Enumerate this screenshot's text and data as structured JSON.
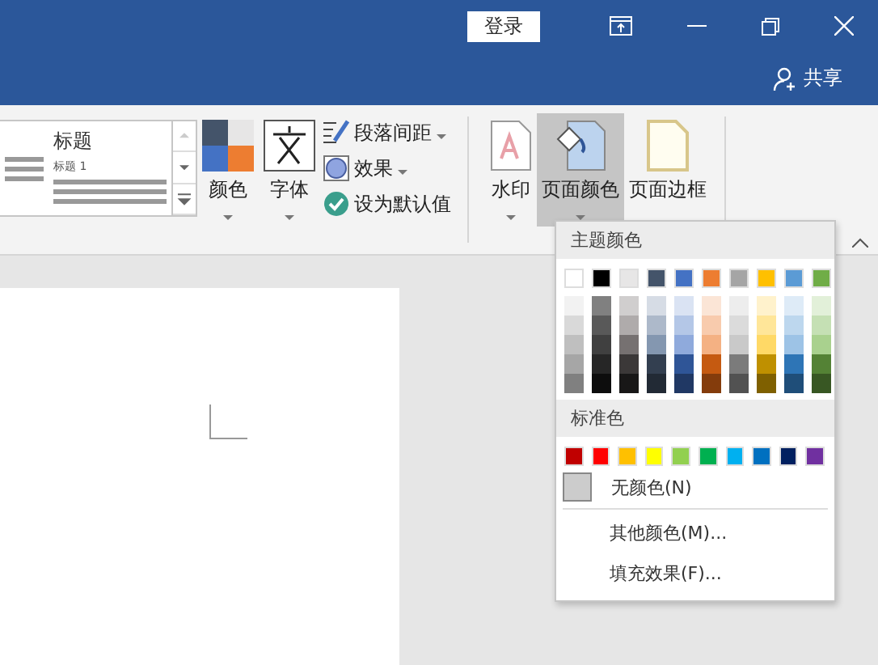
{
  "titlebar": {
    "login": "登录",
    "share": "共享"
  },
  "ribbon": {
    "gallery": {
      "title": "标题",
      "subtitle": "标题 1"
    },
    "colors_button": "颜色",
    "fonts_button": "字体",
    "small_buttons": [
      {
        "kind": "spacing",
        "label": "段落间距",
        "dropdown": true
      },
      {
        "kind": "effects",
        "label": "效果",
        "dropdown": true
      },
      {
        "kind": "default",
        "label": "设为默认值",
        "dropdown": false
      }
    ],
    "page_buttons": [
      {
        "kind": "watermark",
        "label": "水印",
        "dropdown": true,
        "selected": false
      },
      {
        "kind": "color",
        "label": "页面颜色",
        "dropdown": true,
        "selected": true
      },
      {
        "kind": "border",
        "label": "页面边框",
        "dropdown": false,
        "selected": false
      }
    ]
  },
  "menu": {
    "theme_header": "主题颜色",
    "theme_colors": [
      {
        "color": "#ffffff",
        "shades": [
          {
            "color": "#f2f2f2"
          },
          {
            "color": "#d9d9d9"
          },
          {
            "color": "#bfbfbf"
          },
          {
            "color": "#a6a6a6"
          },
          {
            "color": "#808080"
          }
        ]
      },
      {
        "color": "#000000",
        "shades": [
          {
            "color": "#808080"
          },
          {
            "color": "#595959"
          },
          {
            "color": "#404040"
          },
          {
            "color": "#262626"
          },
          {
            "color": "#0d0d0d"
          }
        ]
      },
      {
        "color": "#e7e6e6",
        "shades": [
          {
            "color": "#d0cece"
          },
          {
            "color": "#afabab"
          },
          {
            "color": "#767171"
          },
          {
            "color": "#3b3838"
          },
          {
            "color": "#181717"
          }
        ]
      },
      {
        "color": "#44546a",
        "shades": [
          {
            "color": "#d6dce5"
          },
          {
            "color": "#adb9ca"
          },
          {
            "color": "#8497b0"
          },
          {
            "color": "#333f50"
          },
          {
            "color": "#222a35"
          }
        ]
      },
      {
        "color": "#4472c4",
        "shades": [
          {
            "color": "#dae3f3"
          },
          {
            "color": "#b4c7e7"
          },
          {
            "color": "#8faadc"
          },
          {
            "color": "#2f5597"
          },
          {
            "color": "#203864"
          }
        ]
      },
      {
        "color": "#ed7d31",
        "shades": [
          {
            "color": "#fbe5d6"
          },
          {
            "color": "#f8cbad"
          },
          {
            "color": "#f4b183"
          },
          {
            "color": "#c55a11"
          },
          {
            "color": "#843c0c"
          }
        ]
      },
      {
        "color": "#a5a5a5",
        "shades": [
          {
            "color": "#ededed"
          },
          {
            "color": "#dbdbdb"
          },
          {
            "color": "#c9c9c9"
          },
          {
            "color": "#7b7b7b"
          },
          {
            "color": "#525252"
          }
        ]
      },
      {
        "color": "#ffc000",
        "shades": [
          {
            "color": "#fff2cc"
          },
          {
            "color": "#ffe699"
          },
          {
            "color": "#ffd966"
          },
          {
            "color": "#bf9000"
          },
          {
            "color": "#7f6000"
          }
        ]
      },
      {
        "color": "#5b9bd5",
        "shades": [
          {
            "color": "#deebf7"
          },
          {
            "color": "#bdd7ee"
          },
          {
            "color": "#9dc3e6"
          },
          {
            "color": "#2e75b6"
          },
          {
            "color": "#1f4e79"
          }
        ]
      },
      {
        "color": "#70ad47",
        "shades": [
          {
            "color": "#e2f0d9"
          },
          {
            "color": "#c5e0b4"
          },
          {
            "color": "#a9d18e"
          },
          {
            "color": "#548235"
          },
          {
            "color": "#385723"
          }
        ]
      }
    ],
    "standard_header": "标准色",
    "standard_colors": [
      {
        "color": "#c00000"
      },
      {
        "color": "#ff0000"
      },
      {
        "color": "#ffc000"
      },
      {
        "color": "#ffff00"
      },
      {
        "color": "#92d050"
      },
      {
        "color": "#00b050"
      },
      {
        "color": "#00b0f0"
      },
      {
        "color": "#0070c0"
      },
      {
        "color": "#002060"
      },
      {
        "color": "#7030a0"
      }
    ],
    "no_color": "无颜色(N)",
    "items": [
      "其他颜色(M)...",
      "填充效果(F)..."
    ]
  }
}
